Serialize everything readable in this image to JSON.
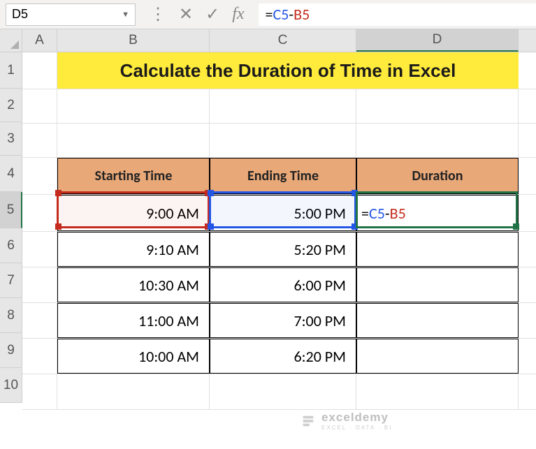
{
  "name_box": "D5",
  "formula": {
    "c5": "C5",
    "b5": "B5"
  },
  "columns": {
    "A": "A",
    "B": "B",
    "C": "C",
    "D": "D"
  },
  "rows": [
    "1",
    "2",
    "3",
    "4",
    "5",
    "6",
    "7",
    "8",
    "9",
    "10"
  ],
  "title": "Calculate the Duration of Time in Excel",
  "headers": {
    "start": "Starting Time",
    "end": "Ending Time",
    "dur": "Duration"
  },
  "data": [
    {
      "start": "9:00 AM",
      "end": "5:00 PM",
      "dur": "=C5-B5"
    },
    {
      "start": "9:10 AM",
      "end": "5:20 PM",
      "dur": ""
    },
    {
      "start": "10:30 AM",
      "end": "6:00 PM",
      "dur": ""
    },
    {
      "start": "11:00 AM",
      "end": "7:00 PM",
      "dur": ""
    },
    {
      "start": "10:00 AM",
      "end": "6:20 PM",
      "dur": ""
    }
  ],
  "watermark": {
    "name": "exceldemy",
    "tag": "EXCEL · DATA · BI"
  }
}
